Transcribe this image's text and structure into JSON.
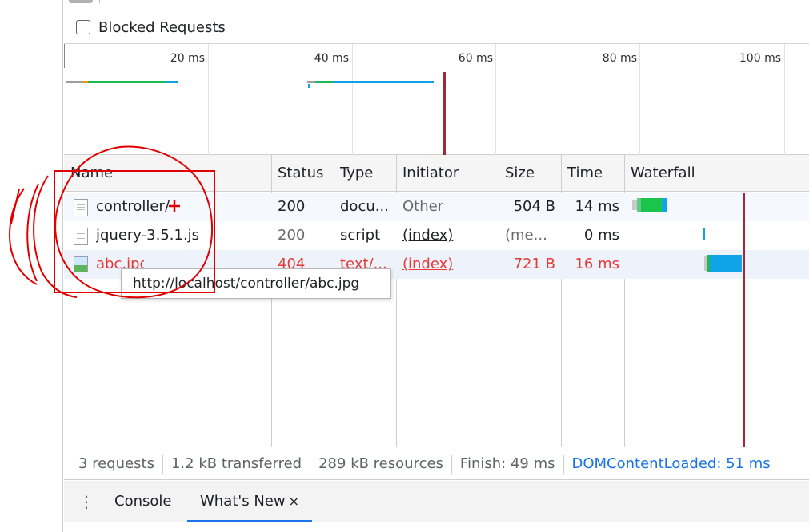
{
  "filter_bar": {
    "blocked_requests_label": "Blocked Requests"
  },
  "overview": {
    "ticks": [
      "20 ms",
      "40 ms",
      "60 ms",
      "80 ms",
      "100 ms"
    ]
  },
  "table": {
    "columns": [
      "Name",
      "Status",
      "Type",
      "Initiator",
      "Size",
      "Time",
      "Waterfall"
    ],
    "rows": [
      {
        "name": "controller/",
        "status": "200",
        "type": "docu...",
        "initiator": "Other",
        "size": "504 B",
        "time": "14 ms"
      },
      {
        "name": "jquery-3.5.1.js",
        "status": "200",
        "type": "script",
        "initiator": "(index)",
        "size": "(me...",
        "time": "0 ms"
      },
      {
        "name": "abc.jpg",
        "status": "404",
        "type": "text/...",
        "initiator": "(index)",
        "size": "721 B",
        "time": "16 ms"
      }
    ]
  },
  "tooltip": "http://localhost/controller/abc.jpg",
  "status_bar": {
    "requests": "3 requests",
    "transferred": "1.2 kB transferred",
    "resources": "289 kB resources",
    "finish": "Finish: 49 ms",
    "dom_loaded": "DOMContentLoaded: 51 ms"
  },
  "drawer": {
    "menu_icon": "kebab-icon",
    "tabs": [
      {
        "label": "Console"
      },
      {
        "label": "What's New",
        "closable": true,
        "active": true
      }
    ],
    "close_glyph": "×"
  },
  "colors": {
    "error_red": "#e53935",
    "link_blue": "#1a73e8",
    "bar_green": "#1db954",
    "bar_blue": "#0fa3e8",
    "load_line": "#9b2c35"
  }
}
